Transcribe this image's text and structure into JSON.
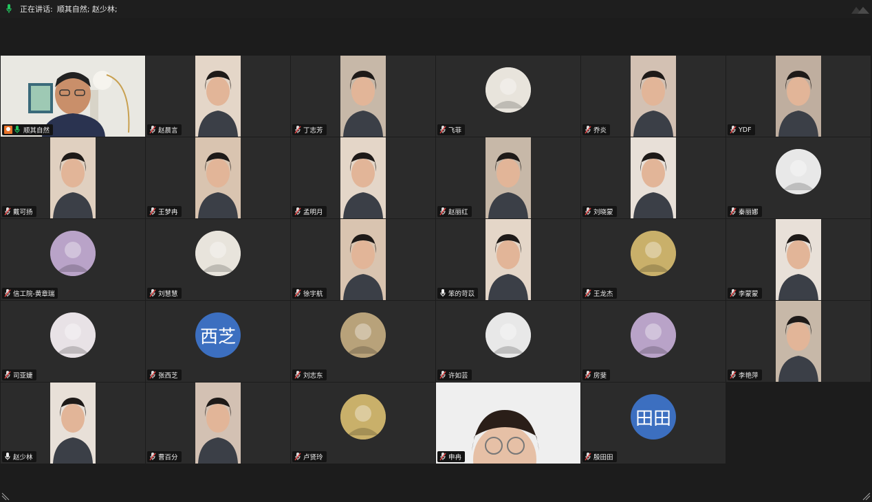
{
  "topbar": {
    "speaking_label": "正在讲话:",
    "speakers": "顺其自然; 赵少林;"
  },
  "colors": {
    "accent_green": "#1fbf5e",
    "avatar_blue": "#3c6fc0",
    "host_orange": "#e8732a",
    "muted_red": "#d94040"
  },
  "participants": [
    {
      "name": "顺其自然",
      "kind": "video",
      "host": true,
      "mic": "active"
    },
    {
      "name": "赵晨言",
      "kind": "video",
      "mic": "muted"
    },
    {
      "name": "丁志芳",
      "kind": "video",
      "mic": "muted"
    },
    {
      "name": "飞菲",
      "kind": "avatar",
      "mic": "muted"
    },
    {
      "name": "乔炎",
      "kind": "video",
      "mic": "muted"
    },
    {
      "name": "YDF",
      "kind": "video",
      "mic": "muted"
    },
    {
      "name": "戴可扬",
      "kind": "video",
      "mic": "muted"
    },
    {
      "name": "王梦冉",
      "kind": "video",
      "mic": "muted"
    },
    {
      "name": "孟明月",
      "kind": "video",
      "mic": "muted"
    },
    {
      "name": "赵丽红",
      "kind": "video",
      "mic": "muted"
    },
    {
      "name": "刘晓蒙",
      "kind": "video",
      "mic": "muted"
    },
    {
      "name": "秦丽娜",
      "kind": "avatar",
      "mic": "muted"
    },
    {
      "name": "信工院-黄章瑞",
      "kind": "avatar",
      "mic": "muted"
    },
    {
      "name": "刘慧慧",
      "kind": "avatar",
      "mic": "muted"
    },
    {
      "name": "徐宇航",
      "kind": "video",
      "mic": "muted"
    },
    {
      "name": "笨的苛苡",
      "kind": "video",
      "mic": "on"
    },
    {
      "name": "王龙杰",
      "kind": "avatar",
      "mic": "muted"
    },
    {
      "name": "李蒙蒙",
      "kind": "video",
      "mic": "muted"
    },
    {
      "name": "司亚婕",
      "kind": "avatar",
      "mic": "muted"
    },
    {
      "name": "张西芝",
      "kind": "text-avatar",
      "avatar_text": "西芝",
      "mic": "muted"
    },
    {
      "name": "刘志东",
      "kind": "avatar",
      "mic": "muted"
    },
    {
      "name": "许如芸",
      "kind": "avatar",
      "mic": "muted"
    },
    {
      "name": "房斐",
      "kind": "avatar",
      "mic": "muted"
    },
    {
      "name": "李艳萍",
      "kind": "video",
      "mic": "muted"
    },
    {
      "name": "赵少林",
      "kind": "video",
      "mic": "on"
    },
    {
      "name": "曹百分",
      "kind": "video",
      "mic": "muted"
    },
    {
      "name": "卢贤玲",
      "kind": "avatar",
      "mic": "muted"
    },
    {
      "name": "申冉",
      "kind": "video-full",
      "mic": "muted"
    },
    {
      "name": "殷田田",
      "kind": "text-avatar",
      "avatar_text": "田田",
      "mic": "muted"
    }
  ]
}
